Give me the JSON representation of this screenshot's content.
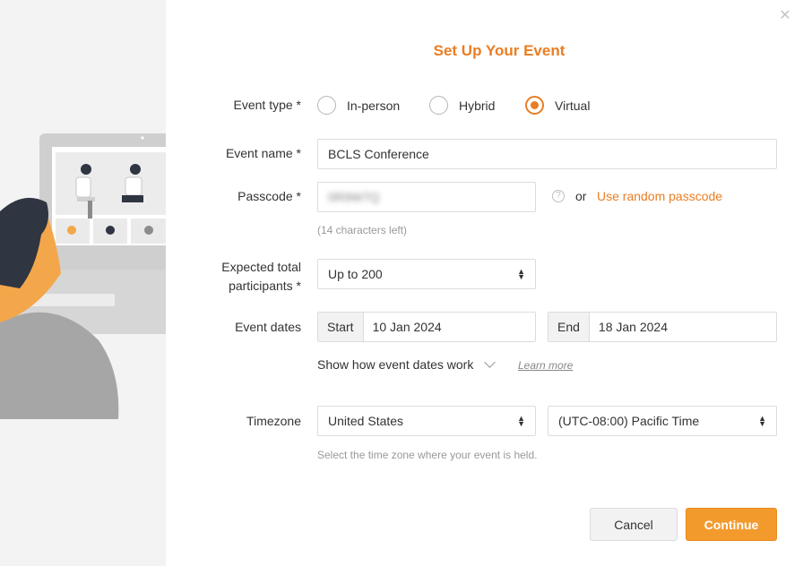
{
  "dialog": {
    "title": "Set Up Your Event",
    "close_icon": "close-icon"
  },
  "event_type": {
    "label": "Event type *",
    "options": [
      {
        "label": "In-person",
        "selected": false
      },
      {
        "label": "Hybrid",
        "selected": false
      },
      {
        "label": "Virtual",
        "selected": true
      }
    ]
  },
  "event_name": {
    "label": "Event name *",
    "value": "BCLS Conference"
  },
  "passcode": {
    "label": "Passcode *",
    "value": "0R9W7Q",
    "hint": "(14 characters left)",
    "or_text": "or",
    "random_link": "Use random passcode",
    "help_icon": "question-icon"
  },
  "participants": {
    "label_line1": "Expected total",
    "label_line2": "participants *",
    "value": "Up to 200"
  },
  "dates": {
    "label": "Event dates",
    "start_prefix": "Start",
    "start_value": "10 Jan 2024",
    "end_prefix": "End",
    "end_value": "18 Jan 2024",
    "expander": "Show how event dates work",
    "learn_more": "Learn more"
  },
  "timezone": {
    "label": "Timezone",
    "country": "United States",
    "zone": "(UTC-08:00) Pacific Time",
    "hint": "Select the time zone where your event is held."
  },
  "actions": {
    "cancel": "Cancel",
    "continue": "Continue"
  },
  "colors": {
    "accent": "#ea7d22",
    "primary_button": "#f39a2d"
  }
}
